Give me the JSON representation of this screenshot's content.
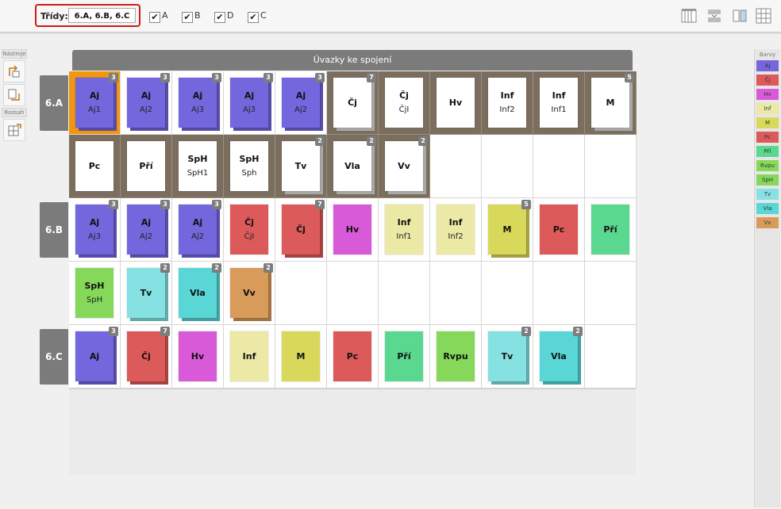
{
  "toolbar": {
    "classes_label": "Třídy:",
    "classes_value": "6.A, 6.B, 6.C",
    "checkboxes": [
      {
        "label": "A",
        "checked": true
      },
      {
        "label": "B",
        "checked": true
      },
      {
        "label": "D",
        "checked": true
      },
      {
        "label": "C",
        "checked": true
      }
    ],
    "icons": [
      "columns-view-icon",
      "merge-view-icon",
      "split-view-icon",
      "grid-view-icon"
    ]
  },
  "left_panel": {
    "tools_title": "Nástroje",
    "range_title": "Rozsah",
    "tools": [
      "rotate-icon",
      "fit-icon"
    ],
    "range_tools": [
      "range-grid-icon"
    ]
  },
  "main": {
    "header": "Úvazky ke spojení",
    "rows": [
      {
        "label": "6.A",
        "lines": [
          [
            {
              "t1": "Aj",
              "t2": "Aj1",
              "color": "#7466dd",
              "badge": "3",
              "cell": "orange"
            },
            {
              "t1": "Aj",
              "t2": "Aj2",
              "color": "#7466dd",
              "badge": "3"
            },
            {
              "t1": "Aj",
              "t2": "Aj3",
              "color": "#7466dd",
              "badge": "3"
            },
            {
              "t1": "Aj",
              "t2": "Aj3",
              "color": "#7466dd",
              "badge": "3"
            },
            {
              "t1": "Aj",
              "t2": "Aj2",
              "color": "#7466dd",
              "badge": "3"
            },
            {
              "t1": "Čj",
              "t2": "",
              "color": "#ffffff",
              "badge": "7",
              "cell": "brown"
            },
            {
              "t1": "Čj",
              "t2": "ČjI",
              "color": "#ffffff",
              "badge": "",
              "cell": "brown"
            },
            {
              "t1": "Hv",
              "t2": "",
              "color": "#ffffff",
              "badge": "",
              "cell": "brown"
            },
            {
              "t1": "Inf",
              "t2": "Inf2",
              "color": "#ffffff",
              "badge": "",
              "cell": "brown"
            },
            {
              "t1": "Inf",
              "t2": "Inf1",
              "color": "#ffffff",
              "badge": "",
              "cell": "brown"
            },
            {
              "t1": "M",
              "t2": "",
              "color": "#ffffff",
              "badge": "5",
              "cell": "brown"
            }
          ],
          [
            {
              "t1": "Pc",
              "t2": "",
              "color": "#ffffff",
              "badge": "",
              "cell": "brown"
            },
            {
              "t1": "Pří",
              "t2": "",
              "color": "#ffffff",
              "badge": "",
              "cell": "brown"
            },
            {
              "t1": "SpH",
              "t2": "SpH1",
              "color": "#ffffff",
              "badge": "",
              "cell": "brown"
            },
            {
              "t1": "SpH",
              "t2": "Sph",
              "color": "#ffffff",
              "badge": "",
              "cell": "brown"
            },
            {
              "t1": "Tv",
              "t2": "",
              "color": "#ffffff",
              "badge": "2",
              "cell": "brown"
            },
            {
              "t1": "Vla",
              "t2": "",
              "color": "#ffffff",
              "badge": "2",
              "cell": "brown"
            },
            {
              "t1": "Vv",
              "t2": "",
              "color": "#ffffff",
              "badge": "2",
              "cell": "brown"
            }
          ]
        ]
      },
      {
        "label": "6.B",
        "lines": [
          [
            {
              "t1": "Aj",
              "t2": "Aj3",
              "color": "#7466dd",
              "badge": "3"
            },
            {
              "t1": "Aj",
              "t2": "Aj2",
              "color": "#7466dd",
              "badge": "3"
            },
            {
              "t1": "Aj",
              "t2": "Aj2",
              "color": "#7466dd",
              "badge": "3"
            },
            {
              "t1": "Čj",
              "t2": "ČjI",
              "color": "#dd5a5a",
              "badge": ""
            },
            {
              "t1": "Čj",
              "t2": "",
              "color": "#dd5a5a",
              "badge": "7"
            },
            {
              "t1": "Hv",
              "t2": "",
              "color": "#d95ad9",
              "badge": ""
            },
            {
              "t1": "Inf",
              "t2": "Inf1",
              "color": "#ece8a6",
              "badge": ""
            },
            {
              "t1": "Inf",
              "t2": "Inf2",
              "color": "#ece8a6",
              "badge": ""
            },
            {
              "t1": "M",
              "t2": "",
              "color": "#d8d85a",
              "badge": "5"
            },
            {
              "t1": "Pc",
              "t2": "",
              "color": "#dd5a5a",
              "badge": ""
            },
            {
              "t1": "Pří",
              "t2": "",
              "color": "#5ad890",
              "badge": ""
            }
          ],
          [
            {
              "t1": "SpH",
              "t2": "SpH",
              "color": "#86d85a",
              "badge": ""
            },
            {
              "t1": "Tv",
              "t2": "",
              "color": "#86e2e2",
              "badge": "2"
            },
            {
              "t1": "Vla",
              "t2": "",
              "color": "#5ad6d6",
              "badge": "2"
            },
            {
              "t1": "Vv",
              "t2": "",
              "color": "#d99b5a",
              "badge": "2"
            }
          ]
        ]
      },
      {
        "label": "6.C",
        "lines": [
          [
            {
              "t1": "Aj",
              "t2": "",
              "color": "#7466dd",
              "badge": "3"
            },
            {
              "t1": "Čj",
              "t2": "",
              "color": "#dd5a5a",
              "badge": "7"
            },
            {
              "t1": "Hv",
              "t2": "",
              "color": "#d95ad9",
              "badge": ""
            },
            {
              "t1": "Inf",
              "t2": "",
              "color": "#ece8a6",
              "badge": ""
            },
            {
              "t1": "M",
              "t2": "",
              "color": "#d8d85a",
              "badge": ""
            },
            {
              "t1": "Pc",
              "t2": "",
              "color": "#dd5a5a",
              "badge": ""
            },
            {
              "t1": "Pří",
              "t2": "",
              "color": "#5ad890",
              "badge": ""
            },
            {
              "t1": "Rvpu",
              "t2": "",
              "color": "#86d85a",
              "badge": ""
            },
            {
              "t1": "Tv",
              "t2": "",
              "color": "#86e2e2",
              "badge": "2"
            },
            {
              "t1": "Vla",
              "t2": "",
              "color": "#5ad6d6",
              "badge": "2"
            }
          ]
        ]
      }
    ]
  },
  "legend": {
    "title": "Barvy",
    "items": [
      {
        "label": "Aj",
        "color": "#7466dd"
      },
      {
        "label": "Čj",
        "color": "#dd5a5a"
      },
      {
        "label": "Hv",
        "color": "#d95ad9"
      },
      {
        "label": "Inf",
        "color": "#ece8a6"
      },
      {
        "label": "M",
        "color": "#d8d85a"
      },
      {
        "label": "Pc",
        "color": "#dd5a5a"
      },
      {
        "label": "Pří",
        "color": "#5ad890"
      },
      {
        "label": "Rvpu",
        "color": "#86d85a"
      },
      {
        "label": "SpH",
        "color": "#86d85a"
      },
      {
        "label": "Tv",
        "color": "#86e2e2"
      },
      {
        "label": "Vla",
        "color": "#5ad6d6"
      },
      {
        "label": "Vv",
        "color": "#d99b5a"
      }
    ]
  }
}
